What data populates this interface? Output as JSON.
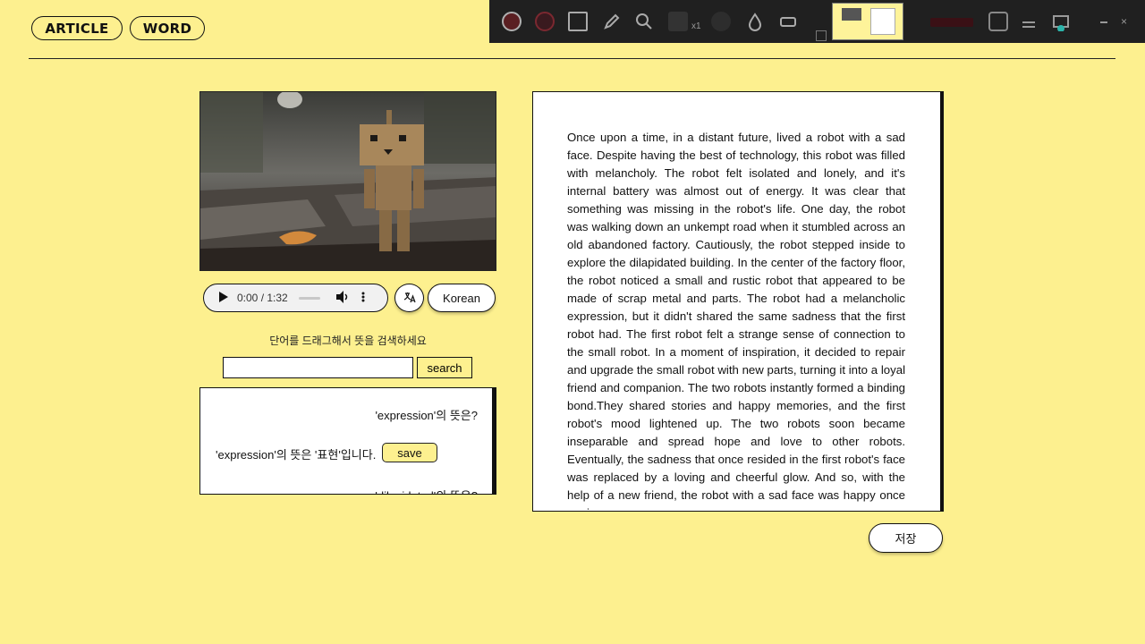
{
  "nav": {
    "article_label": "ARTICLE",
    "word_label": "WORD"
  },
  "recorder_toolbar": {
    "zoom_label": "x1",
    "record_label": ""
  },
  "player": {
    "time": "0:00 / 1:32",
    "translate_icon": "translate-icon",
    "language_label": "Korean"
  },
  "search": {
    "hint": "단어를 드래그해서 뜻을 검색하세요",
    "value": "",
    "button_label": "search"
  },
  "results": [
    {
      "question": "'expression'의 뜻은?",
      "answer": "'expression'의 뜻은 '표현'입니다.",
      "save_label": "save"
    },
    {
      "question": "'dilapidated'의 뜻은?"
    }
  ],
  "article": {
    "text": "Once upon a time, in a distant future, lived a robot with a sad face. Despite having the best of technology, this robot was filled with melancholy. The robot felt isolated and lonely, and it's internal battery was almost out of energy. It was clear that something was missing in the robot's life. One day, the robot was walking down an unkempt road when it stumbled across an old abandoned factory. Cautiously, the robot stepped inside to explore the dilapidated building. In the center of the factory floor, the robot noticed a small and rustic robot that appeared to be made of scrap metal and parts. The robot had a melancholic expression, but it didn't shared the same sadness that the first robot had. The first robot felt a strange sense of connection to the small robot. In a moment of inspiration, it decided to repair and upgrade the small robot with new parts, turning it into a loyal friend and companion. The two robots instantly formed a binding bond.They shared stories and happy memories, and the first robot's mood lightened up. The two robots soon became inseparable and spread hope and love to other robots. Eventually, the sadness that once resided in the first robot's face was replaced by a loving and cheerful glow. And so, with the help of a new friend, the robot with a sad face was happy once again."
  },
  "store_label": "저장",
  "colors": {
    "background": "#fdf08f",
    "ink": "#111111",
    "toolbar": "#202020"
  }
}
